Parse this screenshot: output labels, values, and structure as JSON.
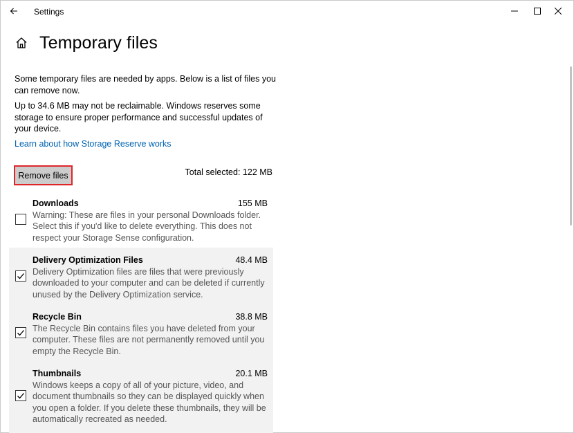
{
  "window": {
    "title": "Settings",
    "controls": [
      "minimize",
      "maximize",
      "close"
    ]
  },
  "page": {
    "title": "Temporary files"
  },
  "intro": {
    "para1": "Some temporary files are needed by apps. Below is a list of files you can remove now.",
    "para2": "Up to 34.6 MB may not be reclaimable. Windows reserves some storage to ensure proper performance and successful updates of your device.",
    "link": "Learn about how Storage Reserve works"
  },
  "actions": {
    "remove_label": "Remove files",
    "total_selected": "Total selected: 122 MB"
  },
  "items": [
    {
      "name": "Downloads",
      "size": "155 MB",
      "checked": false,
      "desc": "Warning: These are files in your personal Downloads folder. Select this if you'd like to delete everything. This does not respect your Storage Sense configuration."
    },
    {
      "name": "Delivery Optimization Files",
      "size": "48.4 MB",
      "checked": true,
      "desc": "Delivery Optimization files are files that were previously downloaded to your computer and can be deleted if currently unused by the Delivery Optimization service."
    },
    {
      "name": "Recycle Bin",
      "size": "38.8 MB",
      "checked": true,
      "desc": "The Recycle Bin contains files you have deleted from your computer. These files are not permanently removed until you empty the Recycle Bin."
    },
    {
      "name": "Thumbnails",
      "size": "20.1 MB",
      "checked": true,
      "desc": "Windows keeps a copy of all of your picture, video, and document thumbnails so they can be displayed quickly when you open a folder. If you delete these thumbnails, they will be automatically recreated as needed."
    }
  ],
  "colors": {
    "accent_link": "#0063b1",
    "highlight_border": "#e0252a",
    "selected_bg": "#f2f2f2"
  }
}
